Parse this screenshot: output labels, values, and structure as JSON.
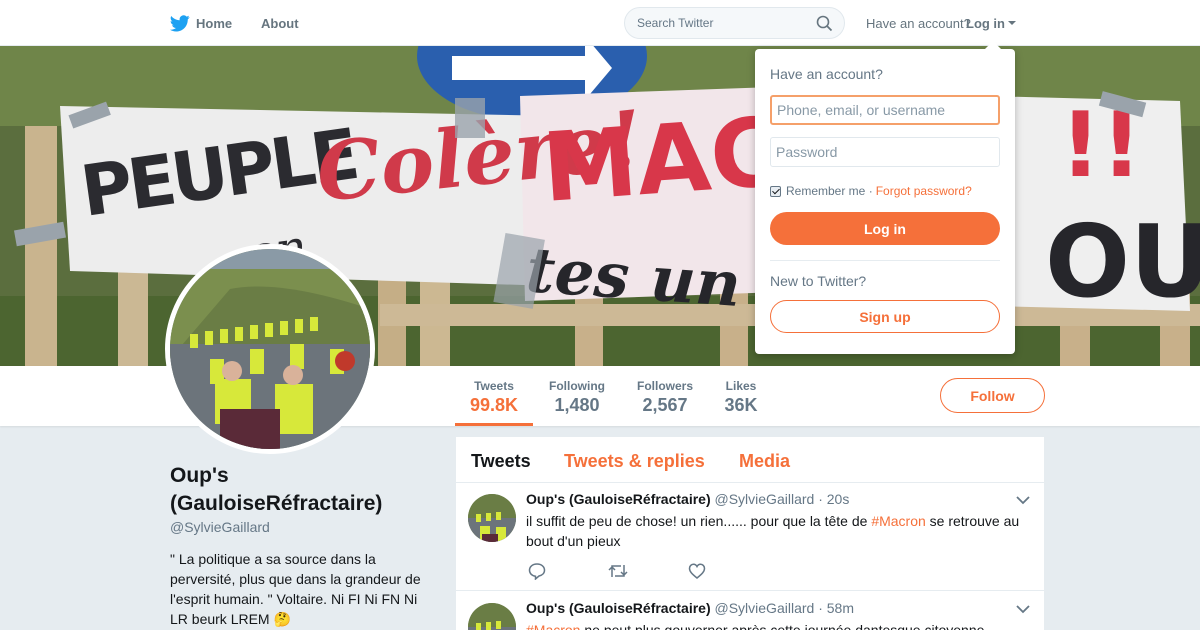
{
  "nav": {
    "home_label": "Home",
    "about_label": "About",
    "search_placeholder": "Search Twitter",
    "have_account": "Have an account?",
    "login_label": "Log in"
  },
  "profile": {
    "name": "Oup's (GauloiseRéfractaire)",
    "handle": "@SylvieGaillard",
    "bio": "\" La politique a sa source dans la perversité, plus que dans la grandeur de l'esprit humain. \" Voltaire. Ni FI Ni FN Ni LR beurk LREM 🤔",
    "follow_label": "Follow",
    "stats": [
      {
        "label": "Tweets",
        "value": "99.8K",
        "active": true
      },
      {
        "label": "Following",
        "value": "1,480"
      },
      {
        "label": "Followers",
        "value": "2,567"
      },
      {
        "label": "Likes",
        "value": "36K"
      }
    ]
  },
  "timeline": {
    "tabs": [
      "Tweets",
      "Tweets & replies",
      "Media"
    ],
    "tweets": [
      {
        "name": "Oup's (GauloiseRéfractaire)",
        "handle": "@SylvieGaillard",
        "time": "20s",
        "text_before": "il suffit de peu de chose! un rien...... pour que la tête de ",
        "hashtag": "#Macron",
        "text_after": " se retrouve au bout d'un pieux"
      },
      {
        "name": "Oup's (GauloiseRéfractaire)",
        "handle": "@SylvieGaillard",
        "time": "58m",
        "hashtag": "#Macron",
        "text_after": " ne peut plus gouverner après cette journée dantesque citoyenne"
      }
    ]
  },
  "login_dropdown": {
    "title": "Have an account?",
    "username_placeholder": "Phone, email, or username",
    "password_placeholder": "Password",
    "remember_label": "Remember me",
    "forgot_label": "Forgot password?",
    "login_button": "Log in",
    "new_label": "New to Twitter?",
    "signup_button": "Sign up"
  },
  "colors": {
    "accent": "#f5703a",
    "muted": "#657786",
    "background": "#e6ecf0"
  },
  "icons": [
    "twitter-bird-icon",
    "search-icon",
    "caret-down-icon",
    "reply-icon",
    "retweet-icon",
    "like-icon",
    "chevron-down-icon"
  ]
}
